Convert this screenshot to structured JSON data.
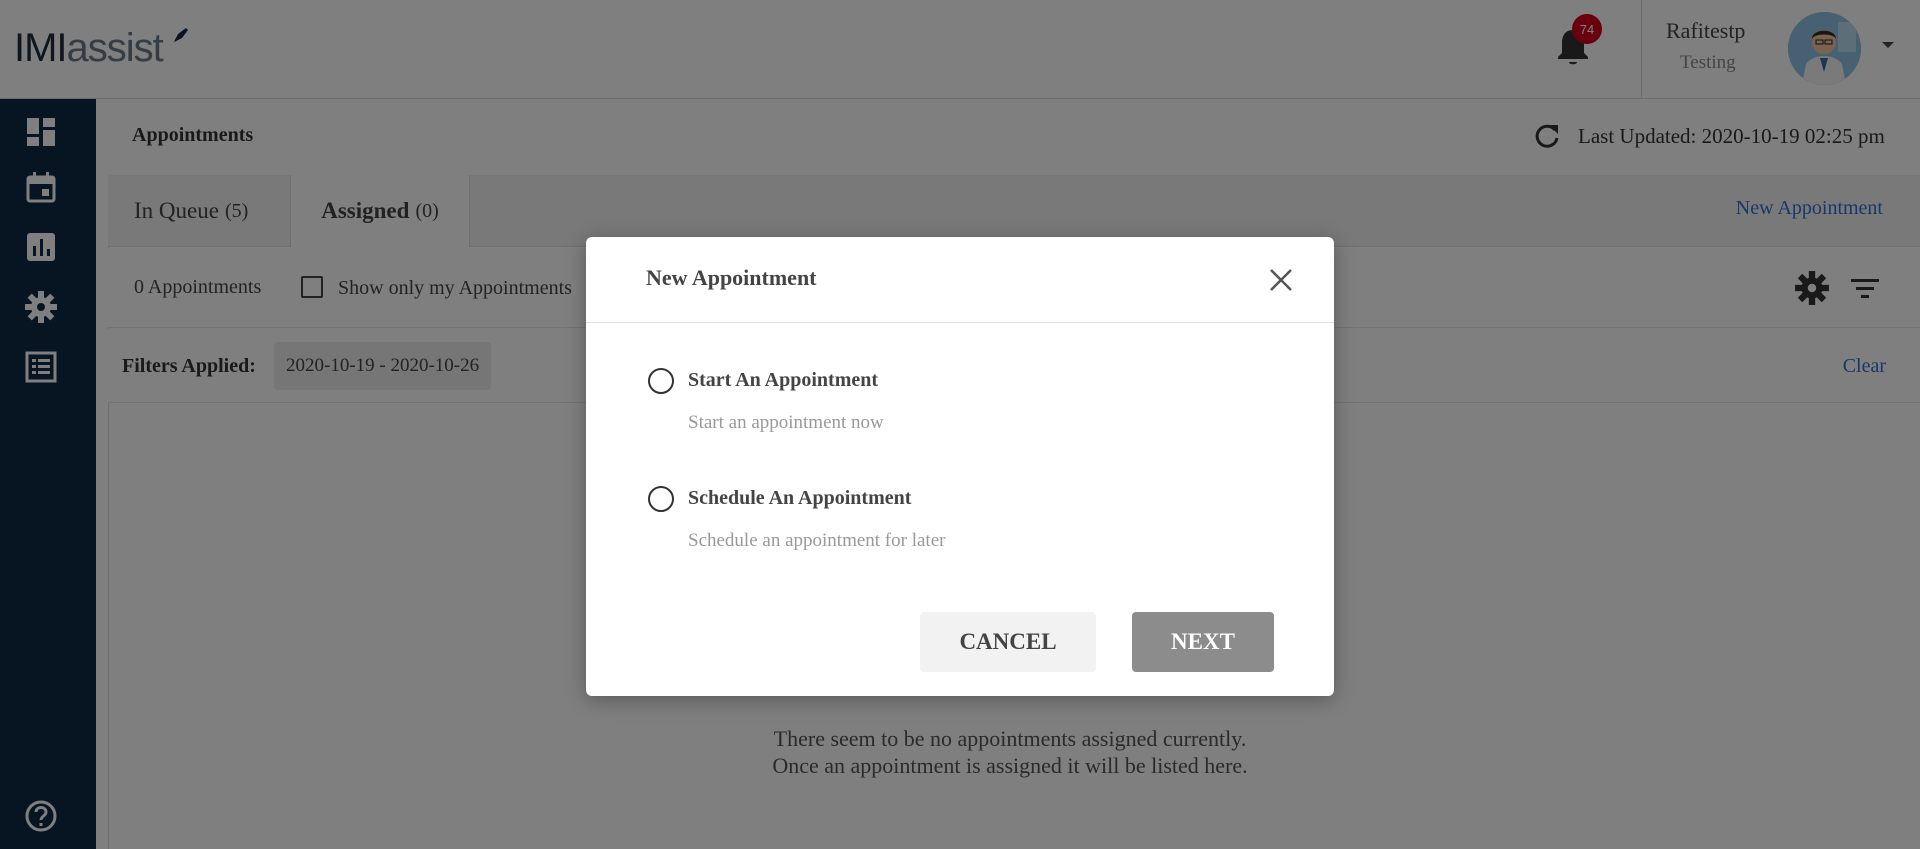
{
  "header": {
    "logo_primary": "IMI",
    "logo_secondary": "assist",
    "notification_count": "74",
    "user_name": "Rafitestp",
    "user_role": "Testing"
  },
  "sidebar": {
    "items": [
      {
        "icon": "dashboard-icon"
      },
      {
        "icon": "calendar-icon"
      },
      {
        "icon": "bar-chart-icon"
      },
      {
        "icon": "settings-icon"
      },
      {
        "icon": "list-icon"
      }
    ],
    "help_icon": "help-icon"
  },
  "page": {
    "title": "Appointments",
    "last_updated": "Last Updated: 2020-10-19 02:25 pm"
  },
  "tabs": [
    {
      "label": "In Queue",
      "count": "(5)"
    },
    {
      "label": "Assigned",
      "count": "(0)"
    }
  ],
  "new_appointment_link": "New Appointment",
  "toolbar": {
    "appointments_count": "0 Appointments",
    "show_mine_label": "Show only my Appointments"
  },
  "filters": {
    "label": "Filters Applied:",
    "chip": "2020-10-19 - 2020-10-26",
    "clear": "Clear"
  },
  "empty_message": "There seem to be no appointments assigned currently. Once an appointment is assigned it will be listed here.",
  "modal": {
    "title": "New Appointment",
    "options": [
      {
        "title": "Start An Appointment",
        "description": "Start an appointment now"
      },
      {
        "title": "Schedule An Appointment",
        "description": "Schedule an appointment for later"
      }
    ],
    "cancel_label": "CANCEL",
    "next_label": "NEXT"
  }
}
